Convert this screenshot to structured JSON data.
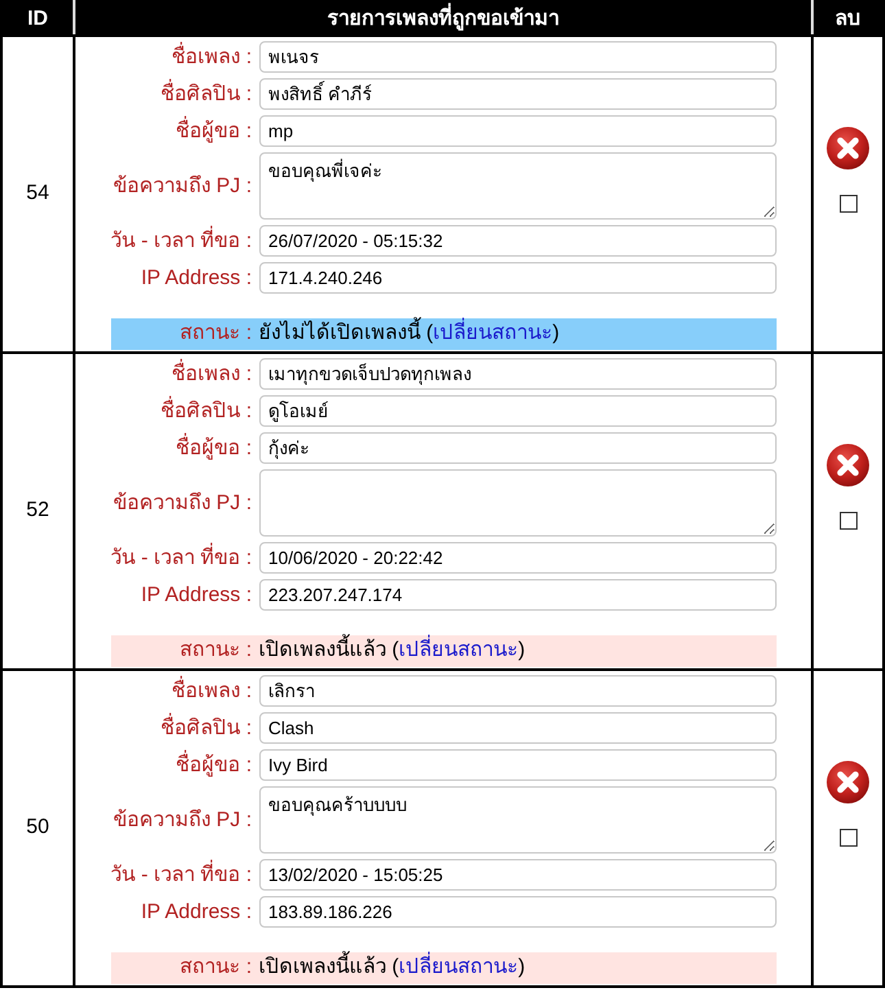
{
  "table": {
    "columns": [
      {
        "label": "ID"
      },
      {
        "label": "รายการเพลงที่ถูกขอเข้ามา"
      },
      {
        "label": "ลบ"
      }
    ],
    "rows": [
      {
        "id": "54",
        "fields": [
          {
            "kind": "input",
            "label": "ชื่อเพลง :",
            "value": "พเนจร"
          },
          {
            "kind": "input",
            "label": "ชื่อศิลปิน :",
            "value": "พงสิทธิ์ คำภีร์"
          },
          {
            "kind": "input",
            "label": "ชื่อผู้ขอ :",
            "value": "mp"
          },
          {
            "kind": "textarea",
            "label": "ข้อความถึง PJ :",
            "value": "ขอบคุณพี่เจค่ะ"
          },
          {
            "kind": "input",
            "label": "วัน - เวลา ที่ขอ :",
            "value": "26/07/2020 - 05:15:32"
          },
          {
            "kind": "input",
            "label": "IP Address :",
            "value": "171.4.240.246"
          }
        ],
        "status": {
          "label": "สถานะ :",
          "played": false,
          "text": "ยังไม่ได้เปิดเพลงนี้",
          "link_before": "(",
          "link": "เปลี่ยนสถานะ",
          "link_after": ")"
        },
        "checked": false
      },
      {
        "id": "52",
        "fields": [
          {
            "kind": "input",
            "label": "ชื่อเพลง :",
            "value": "เมาทุกขวดเจ็บปวดทุกเพลง"
          },
          {
            "kind": "input",
            "label": "ชื่อศิลปิน :",
            "value": "ดูโอเมย์"
          },
          {
            "kind": "input",
            "label": "ชื่อผู้ขอ :",
            "value": "กุ้งค่ะ"
          },
          {
            "kind": "textarea",
            "label": "ข้อความถึง PJ :"
          },
          {
            "kind": "input",
            "label": "วัน - เวลา ที่ขอ :",
            "value": "10/06/2020 - 20:22:42"
          },
          {
            "kind": "input",
            "label": "IP Address :",
            "value": "223.207.247.174"
          }
        ],
        "status": {
          "label": "สถานะ :",
          "played": true,
          "text": "เปิดเพลงนี้แล้ว",
          "link_before": "(",
          "link": "เปลี่ยนสถานะ",
          "link_after": ")"
        },
        "checked": false
      },
      {
        "id": "50",
        "fields": [
          {
            "kind": "input",
            "label": "ชื่อเพลง :",
            "value": "เลิกรา"
          },
          {
            "kind": "input",
            "label": "ชื่อศิลปิน :",
            "value": "Clash"
          },
          {
            "kind": "input",
            "label": "ชื่อผู้ขอ :",
            "value": "Ivy Bird"
          },
          {
            "kind": "textarea",
            "label": "ข้อความถึง PJ :",
            "value": "ขอบคุณคร้าบบบบ"
          },
          {
            "kind": "input",
            "label": "วัน - เวลา ที่ขอ :",
            "value": "13/02/2020 - 15:05:25"
          },
          {
            "kind": "input",
            "label": "IP Address :",
            "value": "183.89.186.226"
          }
        ],
        "status": {
          "label": "สถานะ :",
          "played": true,
          "text": "เปิดเพลงนี้แล้ว",
          "link_before": "(",
          "link": "เปลี่ยนสถานะ",
          "link_after": ")"
        },
        "checked": false
      }
    ]
  }
}
